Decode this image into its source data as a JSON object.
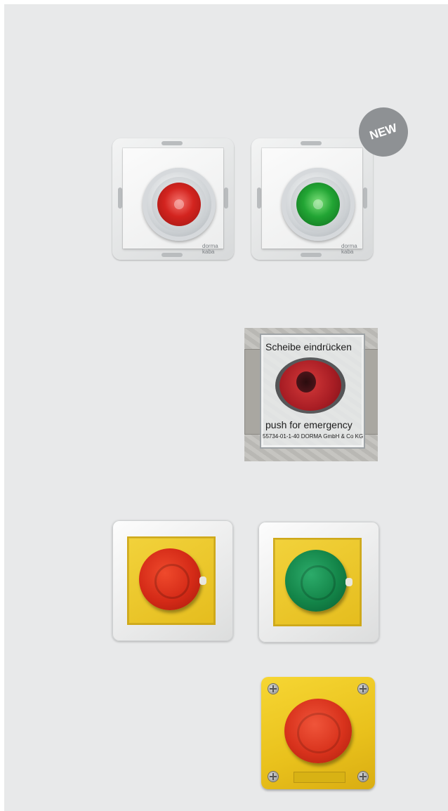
{
  "badge": {
    "text": "NEW"
  },
  "switches": [
    {
      "brand_line1": "dorma",
      "brand_line2": "kaba",
      "lens_color": "red"
    },
    {
      "brand_line1": "dorma",
      "brand_line2": "kaba",
      "lens_color": "green"
    }
  ],
  "glass_cover": {
    "top_text": "Scheibe eindrücken",
    "bottom_text": "push for emergency",
    "part_text": "55734-01-1-40 DORMA GmbH & Co KG"
  },
  "mushroom_switches": [
    {
      "knob_color": "red"
    },
    {
      "knob_color": "green"
    }
  ],
  "colors": {
    "background": "#e8e9ea",
    "badge": "#8e9194",
    "red": "#d42a17",
    "green": "#138448",
    "yellow": "#efcb2c"
  }
}
